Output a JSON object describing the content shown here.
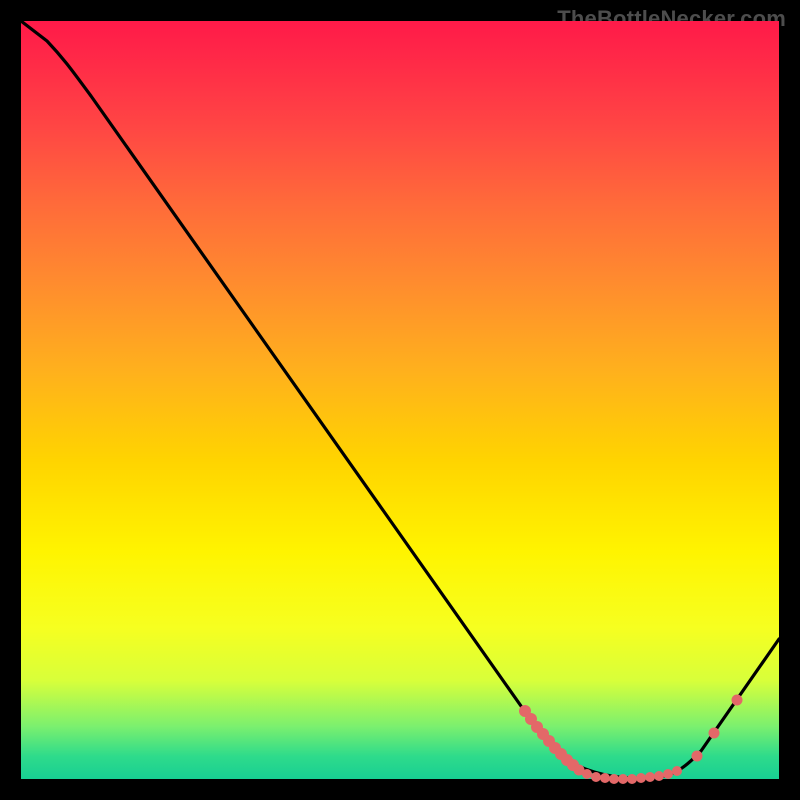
{
  "watermark": "TheBottleNecker.com",
  "chart_data": {
    "type": "line",
    "title": "",
    "xlabel": "",
    "ylabel": "",
    "xlim": [
      0,
      100
    ],
    "ylim": [
      0,
      100
    ],
    "series": [
      {
        "name": "bottleneck-curve",
        "color": "#000000",
        "x": [
          0,
          5,
          10,
          20,
          30,
          40,
          50,
          60,
          68,
          73,
          78,
          83,
          86,
          90,
          95,
          100
        ],
        "y": [
          100,
          97,
          93,
          80,
          66,
          52,
          38,
          24,
          13,
          6,
          1,
          0,
          0,
          2,
          9,
          20
        ]
      }
    ],
    "markers": {
      "name": "marker-band",
      "color": "#e36868",
      "left_cluster": {
        "x_range": [
          68,
          74
        ],
        "y_range": [
          13,
          5
        ]
      },
      "bottom_cluster": {
        "x_range": [
          74,
          86
        ],
        "y": 0
      },
      "right_cluster": {
        "x_range": [
          88,
          95
        ],
        "y_range": [
          1,
          9
        ]
      }
    }
  }
}
